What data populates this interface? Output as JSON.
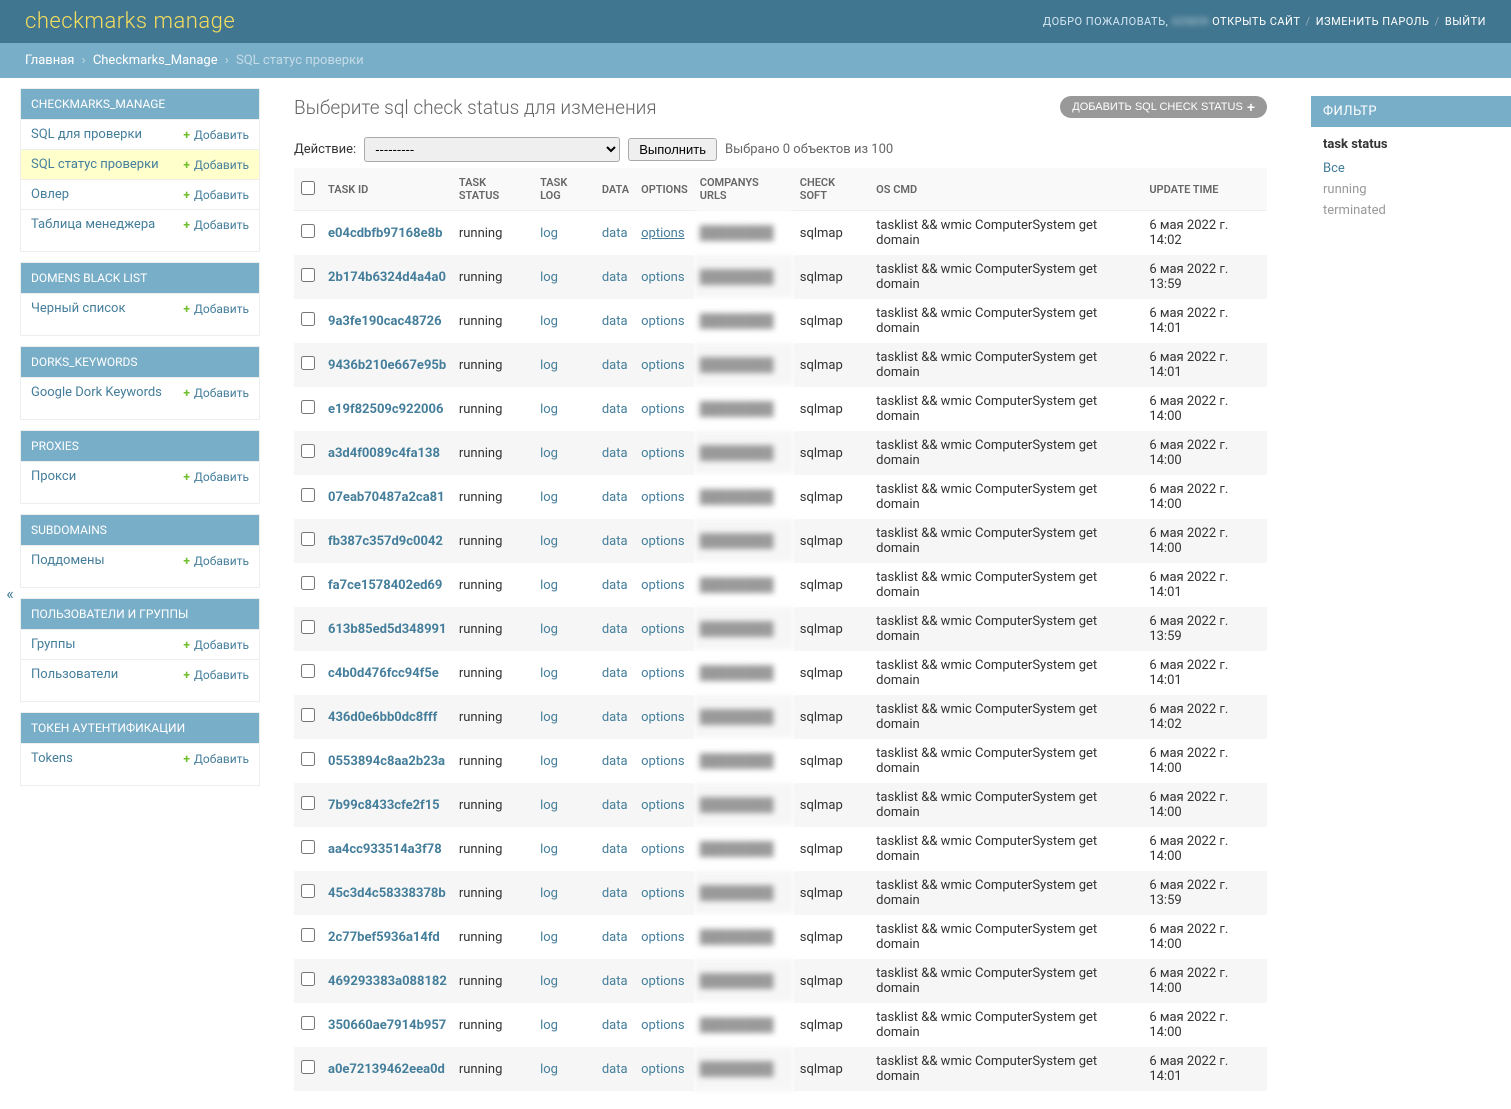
{
  "header": {
    "site_title": "checkmarks manage",
    "welcome": "ДОБРО ПОЖАЛОВАТЬ,",
    "username": "admin",
    "view_site": "ОТКРЫТЬ САЙТ",
    "change_password": "ИЗМЕНИТЬ ПАРОЛЬ",
    "logout": "ВЫЙТИ"
  },
  "breadcrumbs": {
    "home": "Главная",
    "app": "Checkmarks_Manage",
    "current": "SQL статус проверки"
  },
  "sidebar": [
    {
      "title": "CHECKMARKS_MANAGE",
      "items": [
        {
          "name": "SQL для проверки",
          "add": "Добавить"
        },
        {
          "name": "SQL статус проверки",
          "add": "Добавить",
          "active": true
        },
        {
          "name": "Овлер",
          "add": "Добавить"
        },
        {
          "name": "Таблица менеджера",
          "add": "Добавить"
        }
      ]
    },
    {
      "title": "DOMENS BLACK LIST",
      "items": [
        {
          "name": "Черный список",
          "add": "Добавить"
        }
      ]
    },
    {
      "title": "DORKS_KEYWORDS",
      "items": [
        {
          "name": "Google Dork Keywords",
          "add": "Добавить"
        }
      ]
    },
    {
      "title": "PROXIES",
      "items": [
        {
          "name": "Прокси",
          "add": "Добавить"
        }
      ]
    },
    {
      "title": "SUBDOMAINS",
      "items": [
        {
          "name": "Поддомены",
          "add": "Добавить"
        }
      ]
    },
    {
      "title": "ПОЛЬЗОВАТЕЛИ И ГРУППЫ",
      "items": [
        {
          "name": "Группы",
          "add": "Добавить"
        },
        {
          "name": "Пользователи",
          "add": "Добавить"
        }
      ]
    },
    {
      "title": "ТОКЕН АУТЕНТИФИКАЦИИ",
      "items": [
        {
          "name": "Tokens",
          "add": "Добавить"
        }
      ]
    }
  ],
  "content": {
    "page_title": "Выберите sql check status для изменения",
    "add_button": "ДОБАВИТЬ SQL CHECK STATUS",
    "actions": {
      "label": "Действие:",
      "placeholder": "---------",
      "go": "Выполнить",
      "selection": "Выбрано 0 объектов из 100"
    },
    "columns": [
      "",
      "TASK ID",
      "TASK STATUS",
      "TASK LOG",
      "DATA",
      "OPTIONS",
      "COMPANYS URLS",
      "CHECK SOFT",
      "OS CMD",
      "UPDATE TIME"
    ],
    "rows": [
      {
        "task_id": "e04cdbfb97168e8b",
        "status": "running",
        "log": "log",
        "data": "data",
        "options": "options",
        "check_soft": "sqlmap",
        "os_cmd": "tasklist && wmic ComputerSystem get domain",
        "update_time": "6 мая 2022 г. 14:02",
        "opt_underline": true
      },
      {
        "task_id": "2b174b6324d4a4a0",
        "status": "running",
        "log": "log",
        "data": "data",
        "options": "options",
        "check_soft": "sqlmap",
        "os_cmd": "tasklist && wmic ComputerSystem get domain",
        "update_time": "6 мая 2022 г. 13:59"
      },
      {
        "task_id": "9a3fe190cac48726",
        "status": "running",
        "log": "log",
        "data": "data",
        "options": "options",
        "check_soft": "sqlmap",
        "os_cmd": "tasklist && wmic ComputerSystem get domain",
        "update_time": "6 мая 2022 г. 14:01"
      },
      {
        "task_id": "9436b210e667e95b",
        "status": "running",
        "log": "log",
        "data": "data",
        "options": "options",
        "check_soft": "sqlmap",
        "os_cmd": "tasklist && wmic ComputerSystem get domain",
        "update_time": "6 мая 2022 г. 14:01"
      },
      {
        "task_id": "e19f82509c922006",
        "status": "running",
        "log": "log",
        "data": "data",
        "options": "options",
        "check_soft": "sqlmap",
        "os_cmd": "tasklist && wmic ComputerSystem get domain",
        "update_time": "6 мая 2022 г. 14:00"
      },
      {
        "task_id": "a3d4f0089c4fa138",
        "status": "running",
        "log": "log",
        "data": "data",
        "options": "options",
        "check_soft": "sqlmap",
        "os_cmd": "tasklist && wmic ComputerSystem get domain",
        "update_time": "6 мая 2022 г. 14:00"
      },
      {
        "task_id": "07eab70487a2ca81",
        "status": "running",
        "log": "log",
        "data": "data",
        "options": "options",
        "check_soft": "sqlmap",
        "os_cmd": "tasklist && wmic ComputerSystem get domain",
        "update_time": "6 мая 2022 г. 14:00"
      },
      {
        "task_id": "fb387c357d9c0042",
        "status": "running",
        "log": "log",
        "data": "data",
        "options": "options",
        "check_soft": "sqlmap",
        "os_cmd": "tasklist && wmic ComputerSystem get domain",
        "update_time": "6 мая 2022 г. 14:00"
      },
      {
        "task_id": "fa7ce1578402ed69",
        "status": "running",
        "log": "log",
        "data": "data",
        "options": "options",
        "check_soft": "sqlmap",
        "os_cmd": "tasklist && wmic ComputerSystem get domain",
        "update_time": "6 мая 2022 г. 14:01"
      },
      {
        "task_id": "613b85ed5d348991",
        "status": "running",
        "log": "log",
        "data": "data",
        "options": "options",
        "check_soft": "sqlmap",
        "os_cmd": "tasklist && wmic ComputerSystem get domain",
        "update_time": "6 мая 2022 г. 13:59"
      },
      {
        "task_id": "c4b0d476fcc94f5e",
        "status": "running",
        "log": "log",
        "data": "data",
        "options": "options",
        "check_soft": "sqlmap",
        "os_cmd": "tasklist && wmic ComputerSystem get domain",
        "update_time": "6 мая 2022 г. 14:01"
      },
      {
        "task_id": "436d0e6bb0dc8fff",
        "status": "running",
        "log": "log",
        "data": "data",
        "options": "options",
        "check_soft": "sqlmap",
        "os_cmd": "tasklist && wmic ComputerSystem get domain",
        "update_time": "6 мая 2022 г. 14:02"
      },
      {
        "task_id": "0553894c8aa2b23a",
        "status": "running",
        "log": "log",
        "data": "data",
        "options": "options",
        "check_soft": "sqlmap",
        "os_cmd": "tasklist && wmic ComputerSystem get domain",
        "update_time": "6 мая 2022 г. 14:00"
      },
      {
        "task_id": "7b99c8433cfe2f15",
        "status": "running",
        "log": "log",
        "data": "data",
        "options": "options",
        "check_soft": "sqlmap",
        "os_cmd": "tasklist && wmic ComputerSystem get domain",
        "update_time": "6 мая 2022 г. 14:00"
      },
      {
        "task_id": "aa4cc933514a3f78",
        "status": "running",
        "log": "log",
        "data": "data",
        "options": "options",
        "check_soft": "sqlmap",
        "os_cmd": "tasklist && wmic ComputerSystem get domain",
        "update_time": "6 мая 2022 г. 14:00"
      },
      {
        "task_id": "45c3d4c58338378b",
        "status": "running",
        "log": "log",
        "data": "data",
        "options": "options",
        "check_soft": "sqlmap",
        "os_cmd": "tasklist && wmic ComputerSystem get domain",
        "update_time": "6 мая 2022 г. 13:59"
      },
      {
        "task_id": "2c77bef5936a14fd",
        "status": "running",
        "log": "log",
        "data": "data",
        "options": "options",
        "check_soft": "sqlmap",
        "os_cmd": "tasklist && wmic ComputerSystem get domain",
        "update_time": "6 мая 2022 г. 14:00"
      },
      {
        "task_id": "469293383a088182",
        "status": "running",
        "log": "log",
        "data": "data",
        "options": "options",
        "check_soft": "sqlmap",
        "os_cmd": "tasklist && wmic ComputerSystem get domain",
        "update_time": "6 мая 2022 г. 14:00"
      },
      {
        "task_id": "350660ae7914b957",
        "status": "running",
        "log": "log",
        "data": "data",
        "options": "options",
        "check_soft": "sqlmap",
        "os_cmd": "tasklist && wmic ComputerSystem get domain",
        "update_time": "6 мая 2022 г. 14:00"
      },
      {
        "task_id": "a0e72139462eea0d",
        "status": "running",
        "log": "log",
        "data": "data",
        "options": "options",
        "check_soft": "sqlmap",
        "os_cmd": "tasklist && wmic ComputerSystem get domain",
        "update_time": "6 мая 2022 г. 14:01"
      }
    ]
  },
  "filter": {
    "header": "ФИЛЬТР",
    "group_title": "task status",
    "options": [
      {
        "label": "Все",
        "selected": true
      },
      {
        "label": "running"
      },
      {
        "label": "terminated"
      }
    ]
  }
}
